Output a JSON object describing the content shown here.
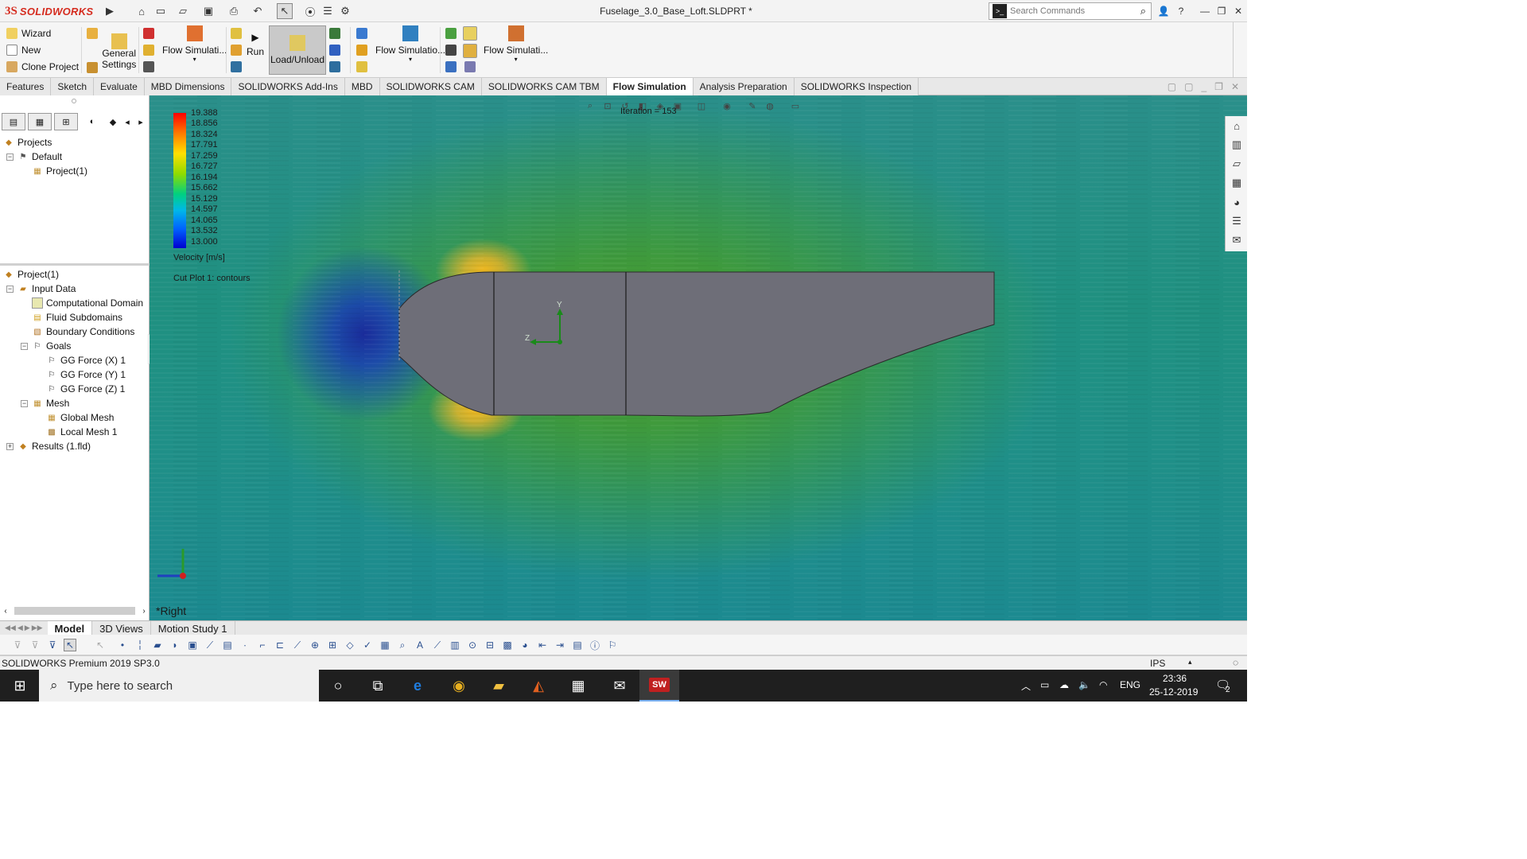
{
  "app": {
    "brand": "SOLIDWORKS",
    "doc_title": "Fuselage_3.0_Base_Loft.SLDPRT *"
  },
  "search": {
    "placeholder": "Search Commands"
  },
  "cmdmgr": {
    "wizard": "Wizard",
    "new": "New",
    "clone": "Clone Project",
    "general_settings_1": "General",
    "general_settings_2": "Settings",
    "flow_sim_1": "Flow Simulati...",
    "run": "Run",
    "load_unload": "Load/Unload",
    "flow_sim_2": "Flow Simulatio...",
    "flow_sim_3": "Flow Simulati..."
  },
  "tabs": [
    "Features",
    "Sketch",
    "Evaluate",
    "MBD Dimensions",
    "SOLIDWORKS Add-Ins",
    "MBD",
    "SOLIDWORKS CAM",
    "SOLIDWORKS CAM TBM",
    "Flow Simulation",
    "Analysis Preparation",
    "SOLIDWORKS Inspection"
  ],
  "active_tab": "Flow Simulation",
  "projects_tree": {
    "root": "Projects",
    "default": "Default",
    "project": "Project(1)"
  },
  "analysis_tree": {
    "root": "Project(1)",
    "input_data": "Input Data",
    "computational_domain": "Computational Domain",
    "fluid_subdomains": "Fluid Subdomains",
    "boundary_conditions": "Boundary Conditions",
    "goals": "Goals",
    "goal_x": "GG Force (X) 1",
    "goal_y": "GG Force (Y) 1",
    "goal_z": "GG Force (Z) 1",
    "mesh": "Mesh",
    "global_mesh": "Global Mesh",
    "local_mesh": "Local Mesh 1",
    "results": "Results (1.fld)"
  },
  "legend": {
    "values": [
      "19.388",
      "18.856",
      "18.324",
      "17.791",
      "17.259",
      "16.727",
      "16.194",
      "15.662",
      "15.129",
      "14.597",
      "14.065",
      "13.532",
      "13.000"
    ],
    "title": "Velocity [m/s]",
    "plot_label": "Cut Plot 1: contours",
    "max": 19.388,
    "min": 13.0
  },
  "viewport": {
    "iteration": "Iteration = 153",
    "view_name": "*Right"
  },
  "triad": {
    "y": "Y",
    "z": "Z"
  },
  "bottom_tabs": [
    "Model",
    "3D Views",
    "Motion Study 1"
  ],
  "active_bottom_tab": "Model",
  "status": {
    "version": "SOLIDWORKS Premium 2019 SP3.0",
    "units": "IPS"
  },
  "taskbar": {
    "search_placeholder": "Type here to search",
    "lang": "ENG",
    "time": "23:36",
    "date": "25-12-2019",
    "notifications": "2"
  },
  "colors": {
    "accent_red": "#d52b1e",
    "fluid_teal": "#1f8f88",
    "model_gray": "#6e6e78"
  }
}
